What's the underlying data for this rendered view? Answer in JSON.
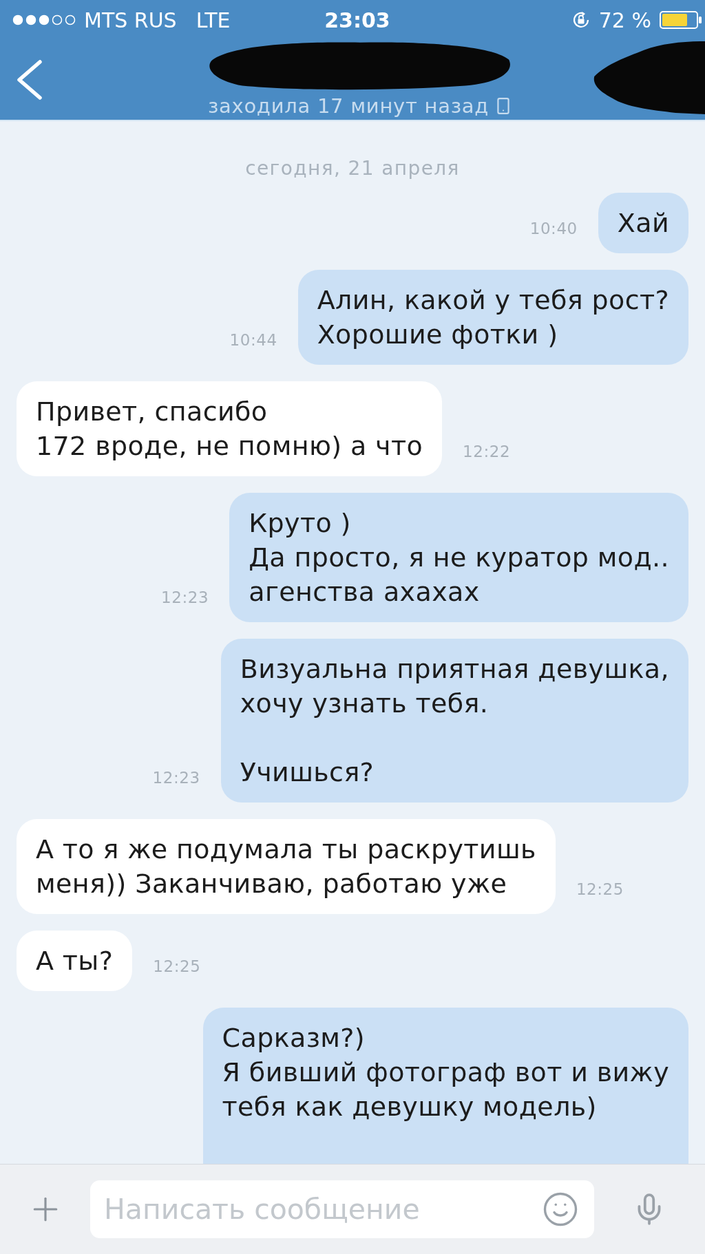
{
  "status_bar": {
    "carrier": "MTS RUS",
    "network": "LTE",
    "time": "23:03",
    "battery": "72 %"
  },
  "header": {
    "subtitle": "заходила 17 минут назад"
  },
  "chat": {
    "date": "сегодня, 21 апреля",
    "messages": [
      {
        "kind": "outgoing",
        "text": "Хай",
        "time": "10:40"
      },
      {
        "kind": "outgoing",
        "text": "Алин, какой у тебя рост?\nХорошие фотки )",
        "time": "10:44"
      },
      {
        "kind": "incoming",
        "text": "Привет, спасибо\n172 вроде, не помню) а что",
        "time": "12:22"
      },
      {
        "kind": "outgoing",
        "text": "Круто )\nДа просто, я не куратор мод..\nагенства ахахах",
        "time": "12:23"
      },
      {
        "kind": "outgoing",
        "text": "Визуальна приятная девушка,\nхочу узнать тебя.\n\nУчишься?",
        "time": "12:23"
      },
      {
        "kind": "incoming",
        "text": "А то я же подумала ты раскрутишь\nменя)) Заканчиваю, работаю уже",
        "time": "12:25"
      },
      {
        "kind": "incoming",
        "text": "А ты?",
        "time": "12:25"
      },
      {
        "kind": "outgoing",
        "text": "Сарказм?)\nЯ бивший фотограф вот и вижу\nтебя как девушку модель)"
      }
    ]
  },
  "composer": {
    "placeholder": "Написать сообщение"
  }
}
